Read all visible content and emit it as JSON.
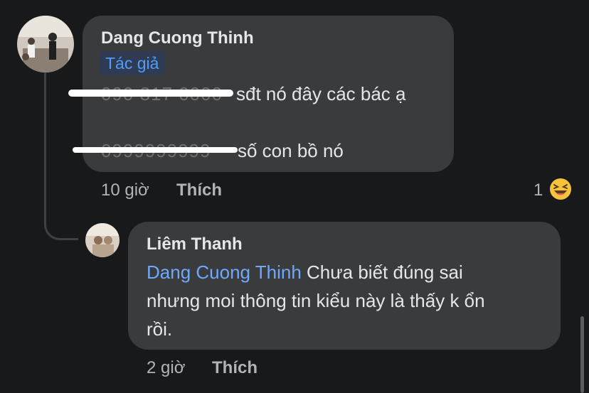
{
  "comment": {
    "author": "Dang Cuong Thinh",
    "badge": "Tác giả",
    "line1_redacted_digits": "090 317 0000",
    "line1_text": "sđt nó đây các bác ạ",
    "line2_redacted_digits": "0999999999",
    "line2_text": "số con bồ nó",
    "time": "10 giờ",
    "like_label": "Thích",
    "reaction_count": "1",
    "reaction_icon": "laughing-emoji-icon"
  },
  "reply": {
    "author": "Liêm Thanh",
    "mention": "Dang Cuong Thinh",
    "text_line1": " Chưa biết đúng sai",
    "text_line2": "nhưng moi thông tin kiểu này là thấy k ổn",
    "text_line3": "rồi.",
    "time": "2 giờ",
    "like_label": "Thích"
  },
  "colors": {
    "background": "#18191a",
    "bubble": "#3a3b3c",
    "mention": "#6ea8ff",
    "badge_text": "#4f9cf9"
  }
}
